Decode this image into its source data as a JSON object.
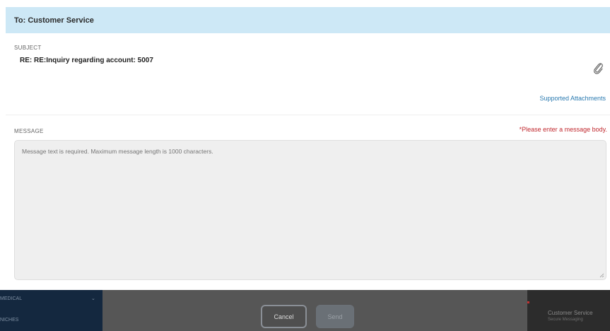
{
  "header": {
    "to_label": "To: Customer Service"
  },
  "subject": {
    "label": "SUBJECT",
    "value": "RE: RE:Inquiry regarding account: 5007"
  },
  "attachments": {
    "icon": "paperclip-icon",
    "link_label": "Supported Attachments"
  },
  "message": {
    "label": "MESSAGE",
    "error": "*Please enter a message body.",
    "placeholder": "Message text is required. Maximum message length is 1000 characters.",
    "value": ""
  },
  "footer": {
    "cancel_label": "Cancel",
    "send_label": "Send",
    "left_nav": {
      "item_1": "MEDICAL",
      "item_2": "NICHES"
    },
    "right_panel": {
      "title": "Customer Service",
      "subtitle": "Secure Messaging"
    }
  },
  "colors": {
    "header_bg": "#cde8f6",
    "link": "#2a7ab0",
    "error": "#c0282e",
    "overlay": "#565656",
    "nav_bg": "#14283f"
  }
}
